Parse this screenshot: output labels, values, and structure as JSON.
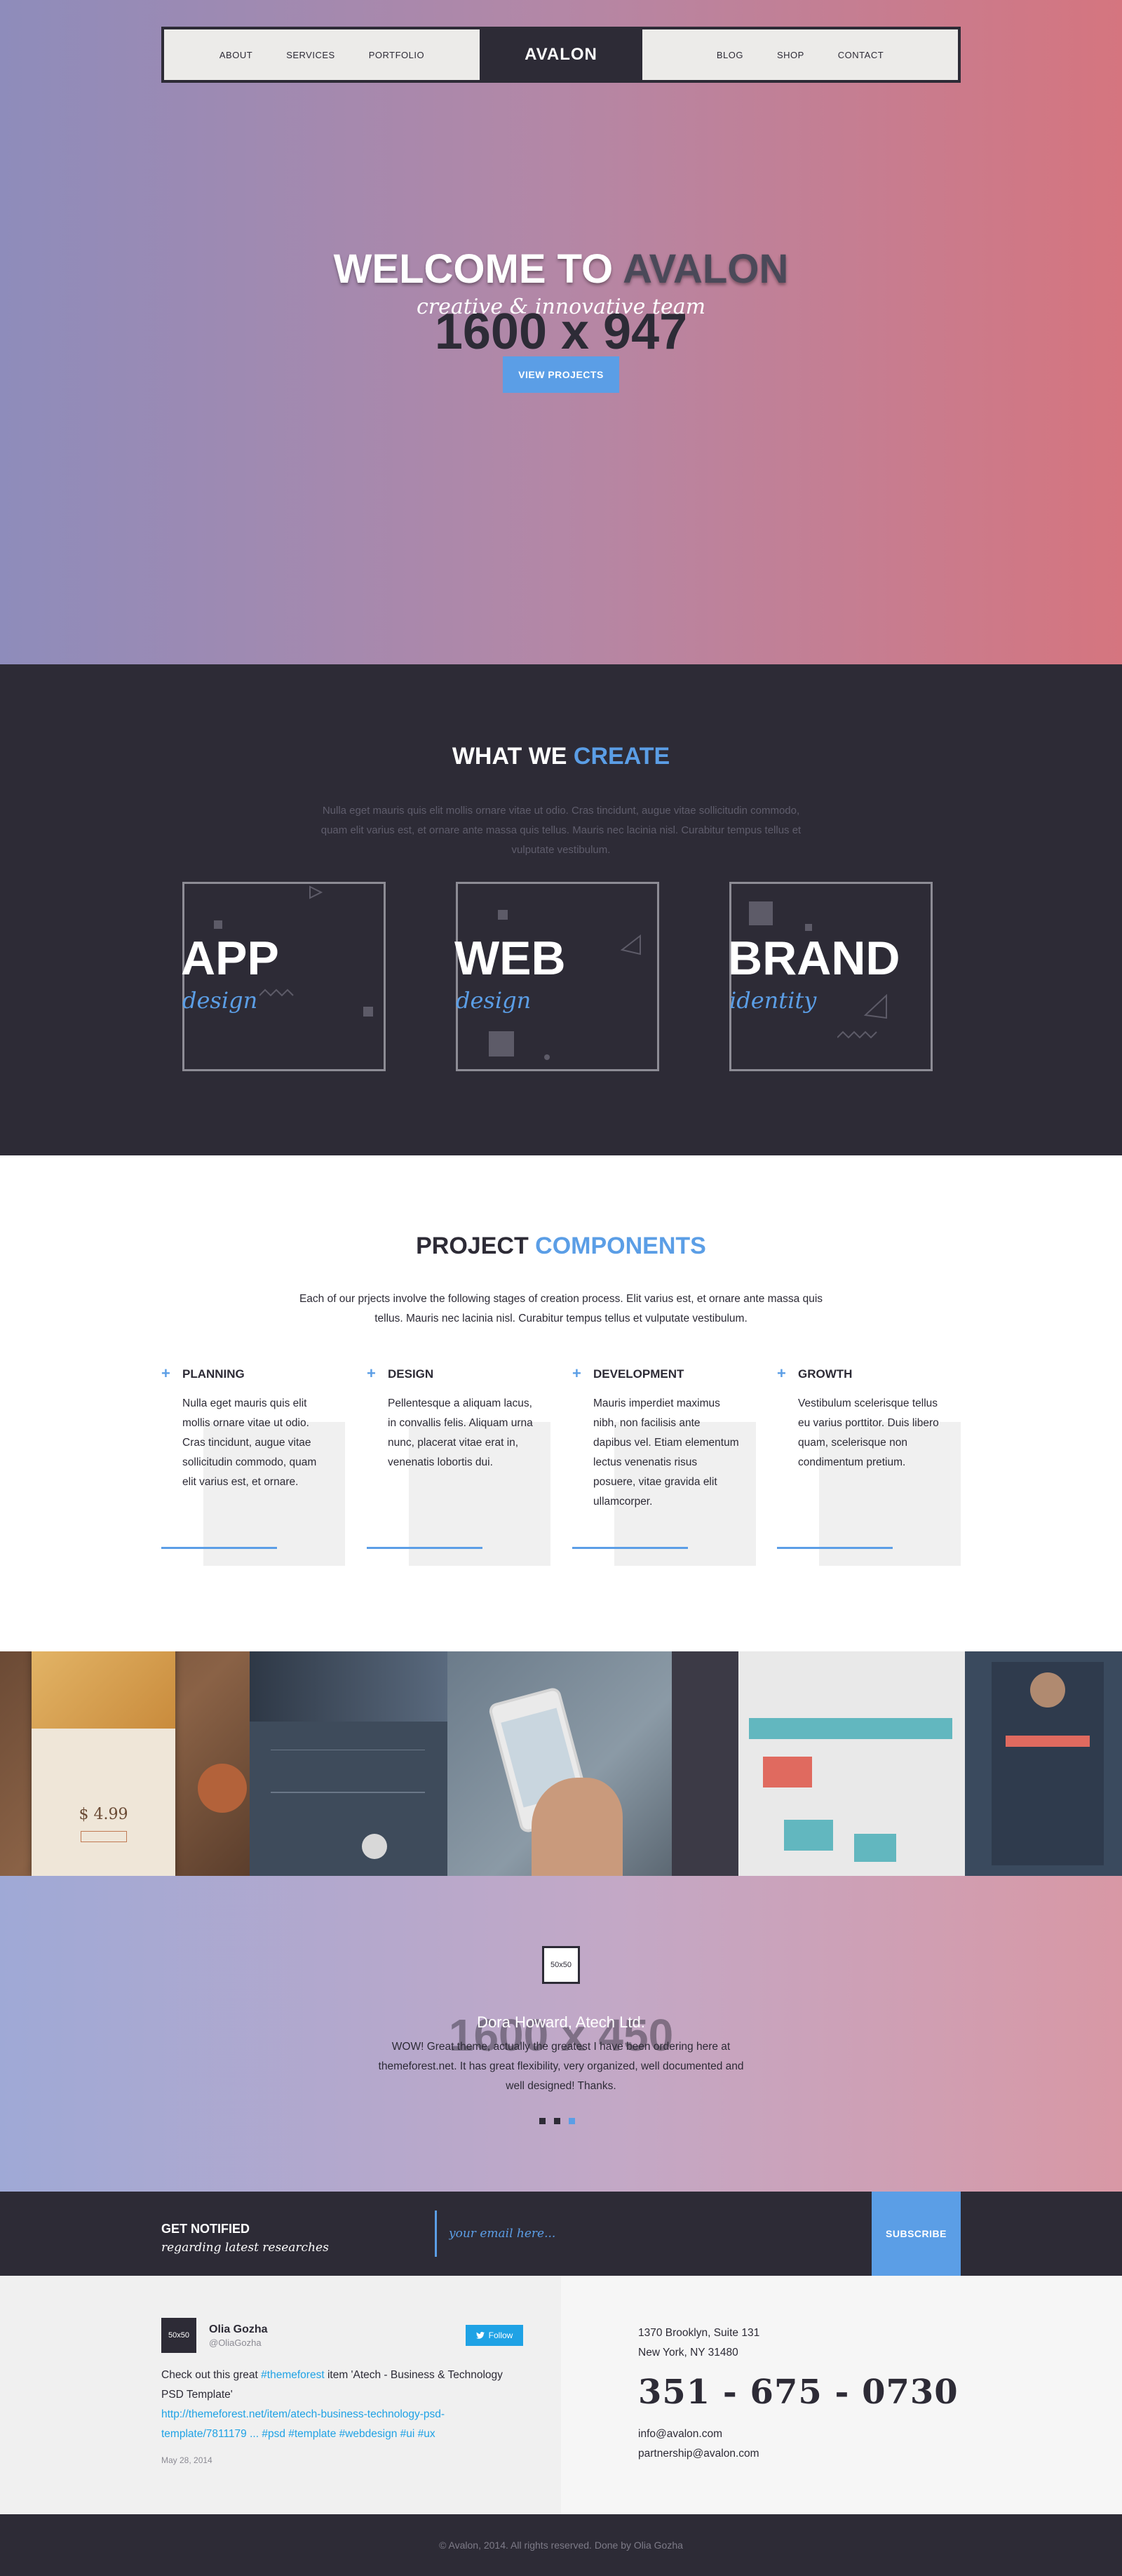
{
  "nav": {
    "left": [
      "ABOUT",
      "SERVICES",
      "PORTFOLIO"
    ],
    "logo": "AVALON",
    "right": [
      "BLOG",
      "SHOP",
      "CONTACT"
    ]
  },
  "hero": {
    "title_prefix": "WELCOME TO ",
    "title_accent": "AVALON",
    "subtitle": "creative & innovative team",
    "placeholder_dims": "1600 x 947",
    "button": "VIEW PROJECTS"
  },
  "create": {
    "title_prefix": "WHAT WE ",
    "title_accent": "CREATE",
    "text": "Nulla eget mauris quis elit mollis ornare vitae ut odio. Cras tincidunt, augue vitae sollicitudin commodo, quam elit varius est, et ornare ante massa quis tellus. Mauris nec lacinia nisl. Curabitur tempus tellus et vulputate vestibulum.",
    "boxes": [
      {
        "big": "APP",
        "small": "design"
      },
      {
        "big": "WEB",
        "small": "design"
      },
      {
        "big": "BRAND",
        "small": "identity"
      }
    ]
  },
  "components": {
    "title_prefix": "PROJECT ",
    "title_accent": "COMPONENTS",
    "text": "Each of our prjects involve the following stages of creation process. Elit varius est, et ornare ante massa quis tellus. Mauris nec lacinia nisl. Curabitur tempus tellus et vulputate vestibulum.",
    "columns": [
      {
        "title": "PLANNING",
        "text": "Nulla eget mauris quis elit mollis ornare vitae ut odio. Cras tincidunt, augue vitae sollicitudin commodo, quam elit varius est, et ornare."
      },
      {
        "title": "DESIGN",
        "text": "Pellentesque a aliquam lacus, in convallis felis. Aliquam urna nunc, placerat vitae erat in, venenatis lobortis dui."
      },
      {
        "title": "DEVELOPMENT",
        "text": "Mauris imperdiet maximus nibh, non facilisis ante dapibus vel. Etiam elementum lectus venenatis risus posuere, vitae gravida elit ullamcorper."
      },
      {
        "title": "GROWTH",
        "text": "Vestibulum scelerisque tellus eu varius porttitor. Duis libero quam, scelerisque non condimentum pretium."
      }
    ]
  },
  "gallery": {
    "price": "$ 4.99"
  },
  "testimonial": {
    "avatar": "50x50",
    "placeholder_dims": "1600 x 450",
    "name": "Dora Howard, Atech Ltd.",
    "quote": "WOW! Great theme, actually the greatest I have been ordering here at themeforest.net. It has great flexibility, very organized, well documented and well designed! Thanks."
  },
  "subscribe": {
    "title": "GET NOTIFIED",
    "subtitle": "regarding latest researches",
    "placeholder": "your email here...",
    "button": "SUBSCRIBE"
  },
  "tweet": {
    "avatar": "50x50",
    "name": "Olia Gozha",
    "handle": "@OliaGozha",
    "follow": "Follow",
    "text_1": "Check out this great ",
    "tag_1": "#themeforest",
    "text_2": " item 'Atech - Business & Technology PSD Template'",
    "link": "http://themeforest.net/item/atech-business-technology-psd-template/7811179 ... #psd #template #webdesign #ui #ux",
    "date": "May 28, 2014"
  },
  "contact": {
    "address_1": "1370 Brooklyn, Suite 131",
    "address_2": "New York, NY 31480",
    "phone": "351 - 675 - 0730",
    "email_1": "info@avalon.com",
    "email_2": "partnership@avalon.com"
  },
  "footer": {
    "copyright": "© Avalon, 2014. All rights reserved. Done by Olia Gozha"
  }
}
